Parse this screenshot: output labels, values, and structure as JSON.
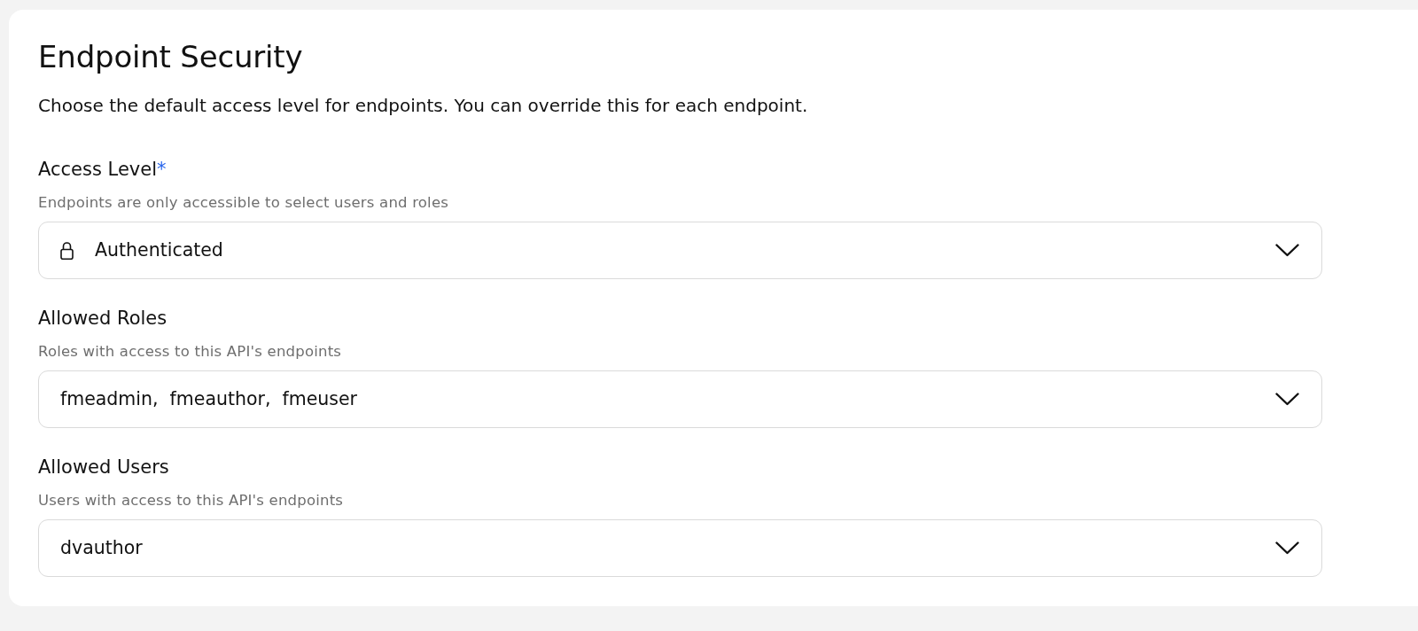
{
  "section": {
    "title": "Endpoint Security",
    "description": "Choose the default access level for endpoints. You can override this for each endpoint."
  },
  "required_marker": "*",
  "fields": [
    {
      "kind": "access_level",
      "label": "Access Level",
      "required": true,
      "hint": "Endpoints are only accessible to select users and roles",
      "value": "Authenticated"
    },
    {
      "kind": "multiselect",
      "label": "Allowed Roles",
      "required": false,
      "hint": "Roles with access to this API's endpoints",
      "value": "fmeadmin,  fmeauthor,  fmeuser"
    },
    {
      "kind": "multiselect",
      "label": "Allowed Users",
      "required": false,
      "hint": "Users with access to this API's endpoints",
      "value": "dvauthor"
    }
  ]
}
